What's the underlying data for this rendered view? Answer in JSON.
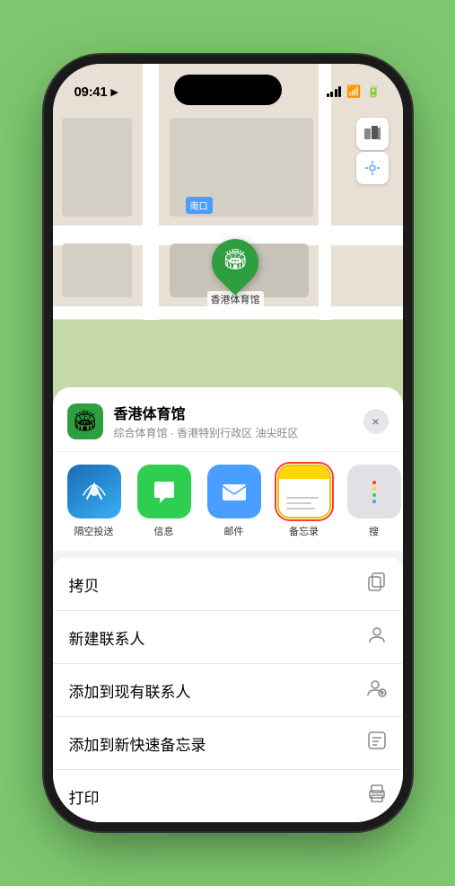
{
  "status_bar": {
    "time": "09:41",
    "location_arrow": "▶"
  },
  "map": {
    "label_nankou": "南口",
    "location_name": "香港体育馆",
    "pin_emoji": "🏟"
  },
  "map_controls": {
    "map_btn": "🗺",
    "location_btn": "◎"
  },
  "place_card": {
    "name": "香港体育馆",
    "subtitle": "综合体育馆 · 香港特别行政区 油尖旺区",
    "close_label": "×"
  },
  "share_items": [
    {
      "id": "airdrop",
      "label": "隔空投送",
      "emoji": "📡"
    },
    {
      "id": "messages",
      "label": "信息",
      "emoji": "💬"
    },
    {
      "id": "mail",
      "label": "邮件",
      "emoji": "✉️"
    },
    {
      "id": "notes",
      "label": "备忘录",
      "emoji": ""
    },
    {
      "id": "more",
      "label": "搜",
      "emoji": ""
    }
  ],
  "actions": [
    {
      "id": "copy",
      "label": "拷贝",
      "icon": "⎘"
    },
    {
      "id": "new-contact",
      "label": "新建联系人",
      "icon": "👤"
    },
    {
      "id": "add-existing",
      "label": "添加到现有联系人",
      "icon": "👤"
    },
    {
      "id": "add-notes",
      "label": "添加到新快速备忘录",
      "icon": "🗒"
    },
    {
      "id": "print",
      "label": "打印",
      "icon": "🖨"
    }
  ]
}
